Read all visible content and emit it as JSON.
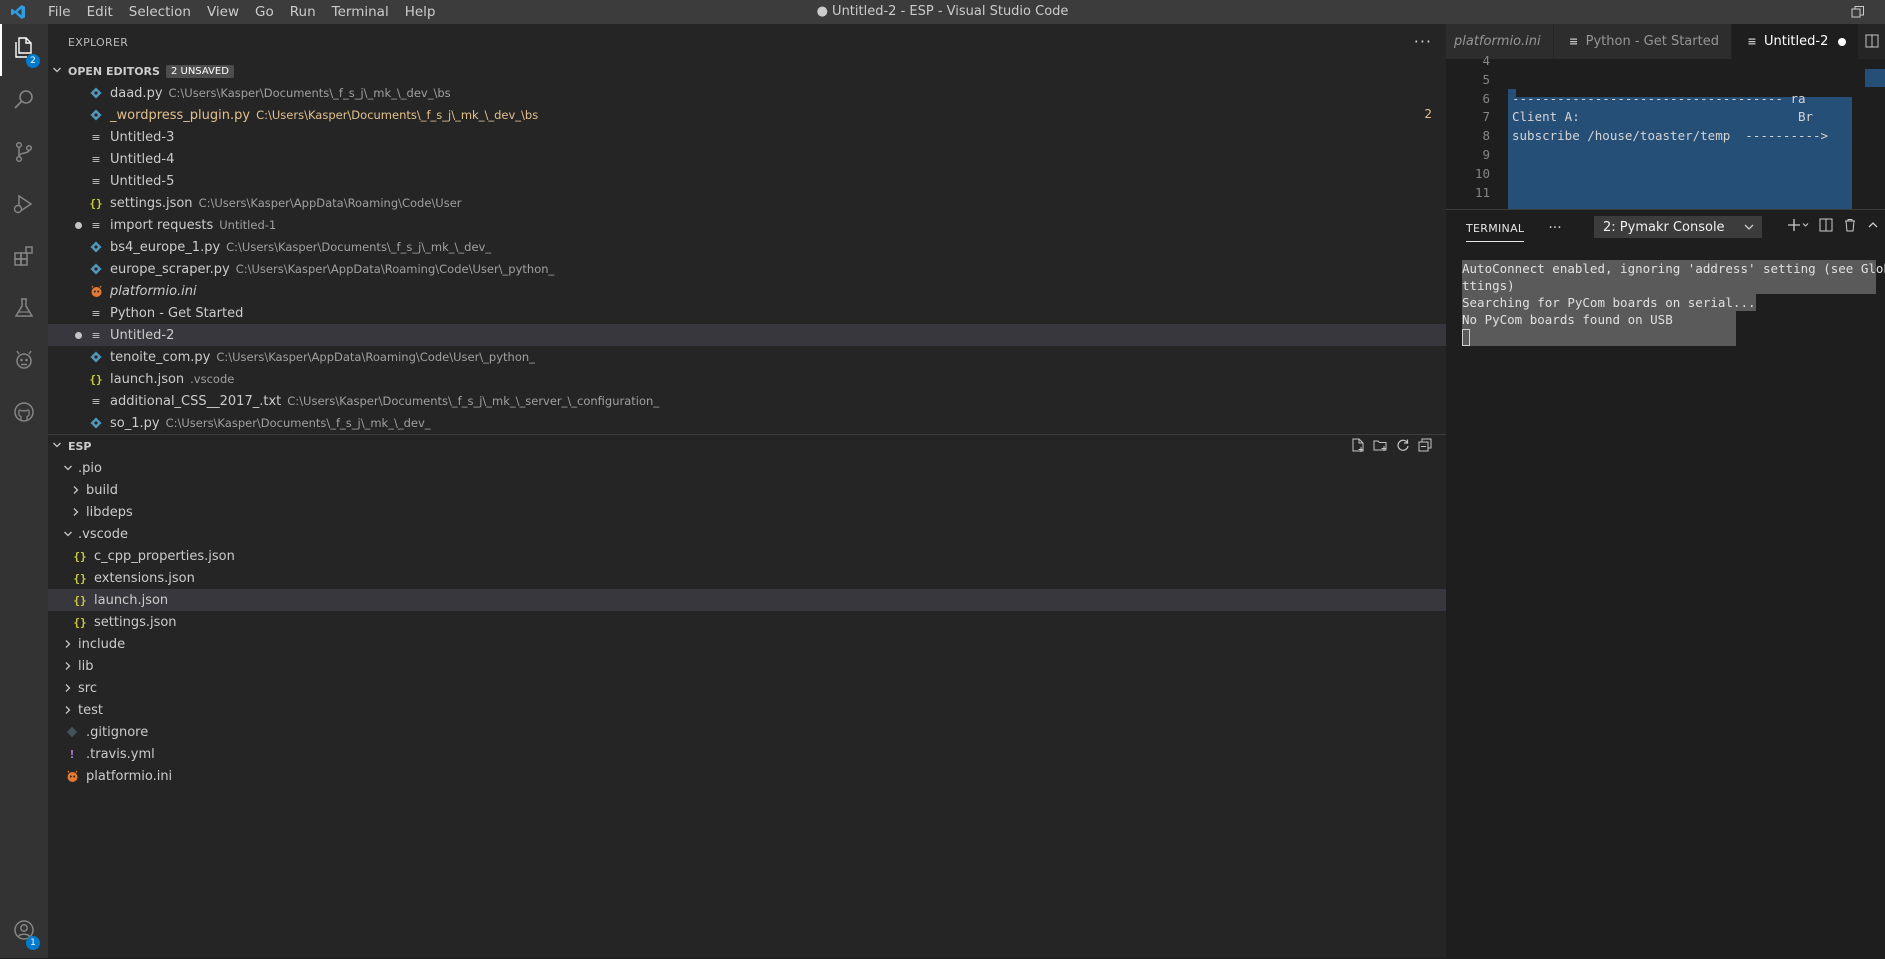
{
  "window": {
    "title": "● Untitled-2 - ESP - Visual Studio Code",
    "menu": [
      "File",
      "Edit",
      "Selection",
      "View",
      "Go",
      "Run",
      "Terminal",
      "Help"
    ]
  },
  "activity_bar": {
    "explorer_badge": "2",
    "accounts_badge": "1",
    "icons": [
      "files-icon",
      "search-icon",
      "source-control-icon",
      "run-debug-icon",
      "extensions-icon",
      "testing-icon",
      "platformio-icon",
      "github-icon",
      "accounts-icon"
    ]
  },
  "explorer": {
    "header": "EXPLORER",
    "more": "···",
    "open_editors": {
      "title": "OPEN EDITORS",
      "badge": "2 UNSAVED",
      "items": [
        {
          "label": "daad.py",
          "desc": "C:\\Users\\Kasper\\Documents\\_f_s_j\\_mk_\\_dev_\\bs",
          "icon": "python"
        },
        {
          "label": "_wordpress_plugin.py",
          "desc": "C:\\Users\\Kasper\\Documents\\_f_s_j\\_mk_\\_dev_\\bs",
          "icon": "python",
          "modified": true,
          "count": "2"
        },
        {
          "label": "Untitled-3",
          "desc": "",
          "icon": "text"
        },
        {
          "label": "Untitled-4",
          "desc": "",
          "icon": "text"
        },
        {
          "label": "Untitled-5",
          "desc": "",
          "icon": "text"
        },
        {
          "label": "settings.json",
          "desc": "C:\\Users\\Kasper\\AppData\\Roaming\\Code\\User",
          "icon": "json"
        },
        {
          "label": "import requests",
          "desc": "Untitled-1",
          "icon": "text",
          "dirty": true
        },
        {
          "label": "bs4_europe_1.py",
          "desc": "C:\\Users\\Kasper\\Documents\\_f_s_j\\_mk_\\_dev_",
          "icon": "python"
        },
        {
          "label": "europe_scraper.py",
          "desc": "C:\\Users\\Kasper\\AppData\\Roaming\\Code\\User\\_python_",
          "icon": "python"
        },
        {
          "label": "platformio.ini",
          "desc": "",
          "icon": "pio",
          "italic": true
        },
        {
          "label": "Python - Get Started",
          "desc": "",
          "icon": "text"
        },
        {
          "label": "Untitled-2",
          "desc": "",
          "icon": "text",
          "dirty": true,
          "selected": true
        },
        {
          "label": "tenoite_com.py",
          "desc": "C:\\Users\\Kasper\\AppData\\Roaming\\Code\\User\\_python_",
          "icon": "python"
        },
        {
          "label": "launch.json",
          "desc": ".vscode",
          "icon": "json"
        },
        {
          "label": "additional_CSS__2017_.txt",
          "desc": "C:\\Users\\Kasper\\Documents\\_f_s_j\\_mk_\\_server_\\_configuration_",
          "icon": "text"
        },
        {
          "label": "so_1.py",
          "desc": "C:\\Users\\Kasper\\Documents\\_f_s_j\\_mk_\\_dev_",
          "icon": "python"
        }
      ]
    },
    "workspace": {
      "title": "ESP",
      "tree": [
        {
          "label": ".pio",
          "depth": 0,
          "chev": "open"
        },
        {
          "label": "build",
          "depth": 1,
          "chev": "closed"
        },
        {
          "label": "libdeps",
          "depth": 1,
          "chev": "closed"
        },
        {
          "label": ".vscode",
          "depth": 0,
          "chev": "open"
        },
        {
          "label": "c_cpp_properties.json",
          "depth": 1,
          "chev": "none",
          "icon": "json"
        },
        {
          "label": "extensions.json",
          "depth": 1,
          "chev": "none",
          "icon": "json"
        },
        {
          "label": "launch.json",
          "depth": 1,
          "chev": "none",
          "icon": "json",
          "selected": true
        },
        {
          "label": "settings.json",
          "depth": 1,
          "chev": "none",
          "icon": "json"
        },
        {
          "label": "include",
          "depth": 0,
          "chev": "closed"
        },
        {
          "label": "lib",
          "depth": 0,
          "chev": "closed"
        },
        {
          "label": "src",
          "depth": 0,
          "chev": "closed"
        },
        {
          "label": "test",
          "depth": 0,
          "chev": "closed"
        },
        {
          "label": ".gitignore",
          "depth": 0,
          "chev": "none",
          "icon": "git"
        },
        {
          "label": ".travis.yml",
          "depth": 0,
          "chev": "none",
          "icon": "yml"
        },
        {
          "label": "platformio.ini",
          "depth": 0,
          "chev": "none",
          "icon": "pio"
        }
      ]
    }
  },
  "editor": {
    "tabs": [
      {
        "label": "platformio.ini",
        "italic": true,
        "active": false
      },
      {
        "label": "Python - Get Started",
        "active": false
      },
      {
        "label": "Untitled-2",
        "active": true,
        "dirty": true
      }
    ],
    "lines": [
      {
        "n": "4",
        "text": ""
      },
      {
        "n": "5",
        "text": ""
      },
      {
        "n": "6",
        "text": "------------------------------------ ra"
      },
      {
        "n": "7",
        "text": "Client A:                             Br"
      },
      {
        "n": "8",
        "text": "subscribe /house/toaster/temp  ---------->"
      },
      {
        "n": "9",
        "text": ""
      },
      {
        "n": "10",
        "text": ""
      },
      {
        "n": "11",
        "text": ""
      }
    ]
  },
  "panel": {
    "tab": "TERMINAL",
    "more": "···",
    "selected_terminal": "2: Pymakr Console",
    "output": [
      "AutoConnect enabled, ignoring 'address' setting (see Global",
      "ttings)",
      "Searching for PyCom boards on serial...",
      "No PyCom boards found on USB"
    ]
  }
}
